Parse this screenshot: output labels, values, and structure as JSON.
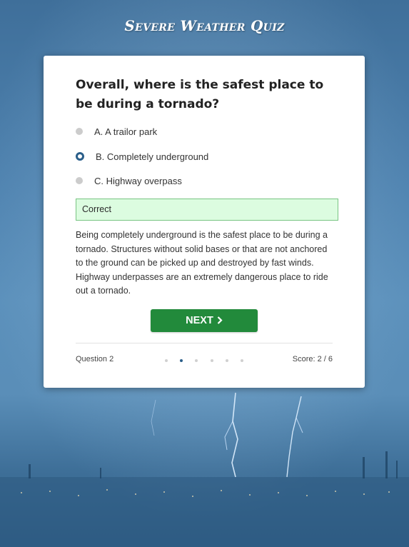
{
  "app": {
    "title": "Severe Weather Quiz"
  },
  "question": {
    "text": "Overall, where is the safest place to be during a tornado?",
    "options": [
      {
        "label": "A. A trailor park",
        "selected": false
      },
      {
        "label": "B. Completely underground",
        "selected": true
      },
      {
        "label": "C. Highway overpass",
        "selected": false
      }
    ]
  },
  "feedback": {
    "status": "Correct",
    "explanation": "Being completely underground is the safest place to be during a tornado. Structures without solid bases or that are not anchored to the ground can be picked up and destroyed by fast winds. Highway underpasses are an extremely dangerous place to ride out a tornado."
  },
  "actions": {
    "next_label": "NEXT"
  },
  "footer": {
    "question_label": "Question 2",
    "score_label": "Score: 2 / 6",
    "progress_total": 6,
    "progress_current": 2
  },
  "colors": {
    "accent": "#2b5f8a",
    "next_button": "#228a3b",
    "correct_bg": "#dcfce0",
    "correct_border": "#79c483"
  },
  "icons": {
    "next": "chevron-right-icon"
  }
}
